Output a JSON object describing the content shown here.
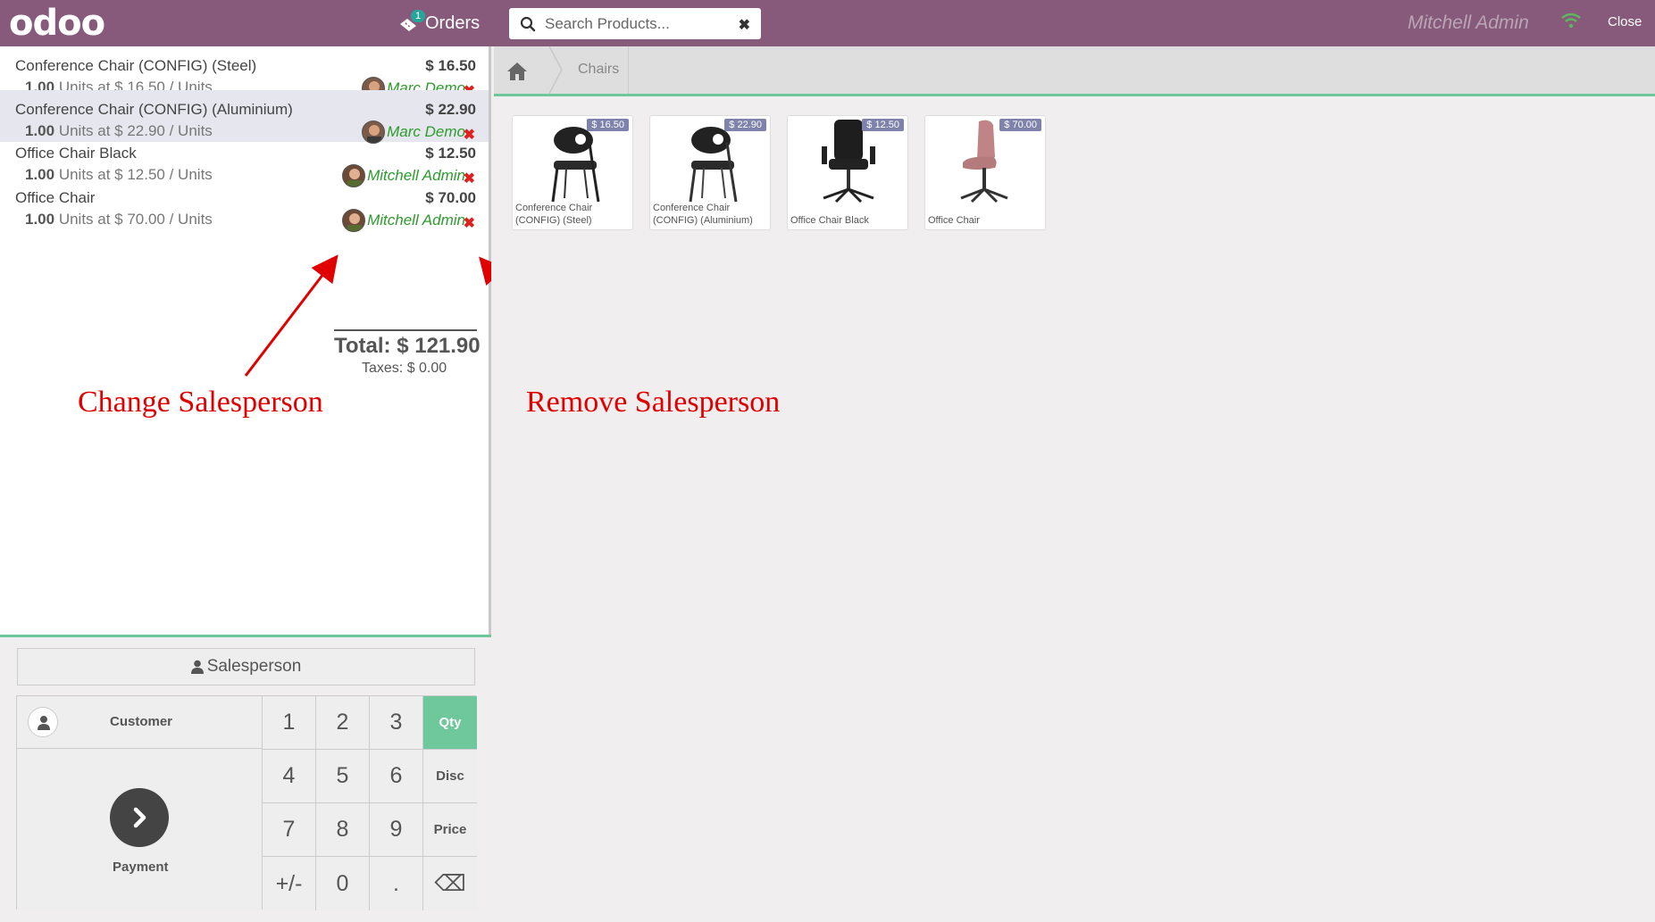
{
  "topbar": {
    "logo": "odoo",
    "orders_label": "Orders",
    "orders_badge": "1",
    "search_placeholder": "Search Products...",
    "user_name": "Mitchell Admin",
    "close_label": "Close"
  },
  "orderlines": [
    {
      "name": "Conference Chair (CONFIG) (Steel)",
      "price": "$ 16.50",
      "qty": "1.00",
      "info": " Units at $ 16.50 / Units",
      "salesperson": "Marc Demo",
      "remove": "✖"
    },
    {
      "name": "Conference Chair (CONFIG) (Aluminium)",
      "price": "$ 22.90",
      "qty": "1.00",
      "info": " Units at $ 22.90 / Units",
      "salesperson": "Marc Demo",
      "remove": "✖"
    },
    {
      "name": "Office Chair Black",
      "price": "$ 12.50",
      "qty": "1.00",
      "info": " Units at $ 12.50 / Units",
      "salesperson": "Mitchell Admin",
      "remove": "✖"
    },
    {
      "name": "Office Chair",
      "price": "$ 70.00",
      "qty": "1.00",
      "info": " Units at $ 70.00 / Units",
      "salesperson": "Mitchell Admin",
      "remove": "✖"
    }
  ],
  "summary": {
    "total": "Total: $ 121.90",
    "taxes": "Taxes: $ 0.00"
  },
  "annotations": {
    "change": "Change Salesperson",
    "remove": "Remove Salesperson"
  },
  "controls": {
    "salesperson_button": "Salesperson",
    "customer_label": "Customer",
    "payment_label": "Payment",
    "keys": [
      "1",
      "2",
      "3",
      "4",
      "5",
      "6",
      "7",
      "8",
      "9",
      "+/-",
      "0",
      "."
    ],
    "modes": [
      "Qty",
      "Disc",
      "Price"
    ],
    "backspace": "⌫",
    "active_mode": "Qty"
  },
  "breadcrumb": {
    "category": "Chairs"
  },
  "products": [
    {
      "name": "Conference Chair (CONFIG) (Steel)",
      "price": "$ 16.50"
    },
    {
      "name": "Conference Chair (CONFIG) (Aluminium)",
      "price": "$ 22.90"
    },
    {
      "name": "Office Chair Black",
      "price": "$ 12.50"
    },
    {
      "name": "Office Chair",
      "price": "$ 70.00"
    }
  ],
  "colors": {
    "brand": "#875a7b",
    "accent": "#6ec89b",
    "salesperson_text": "#2d9c2d",
    "remove": "#e02020",
    "annotation": "#e00000"
  }
}
